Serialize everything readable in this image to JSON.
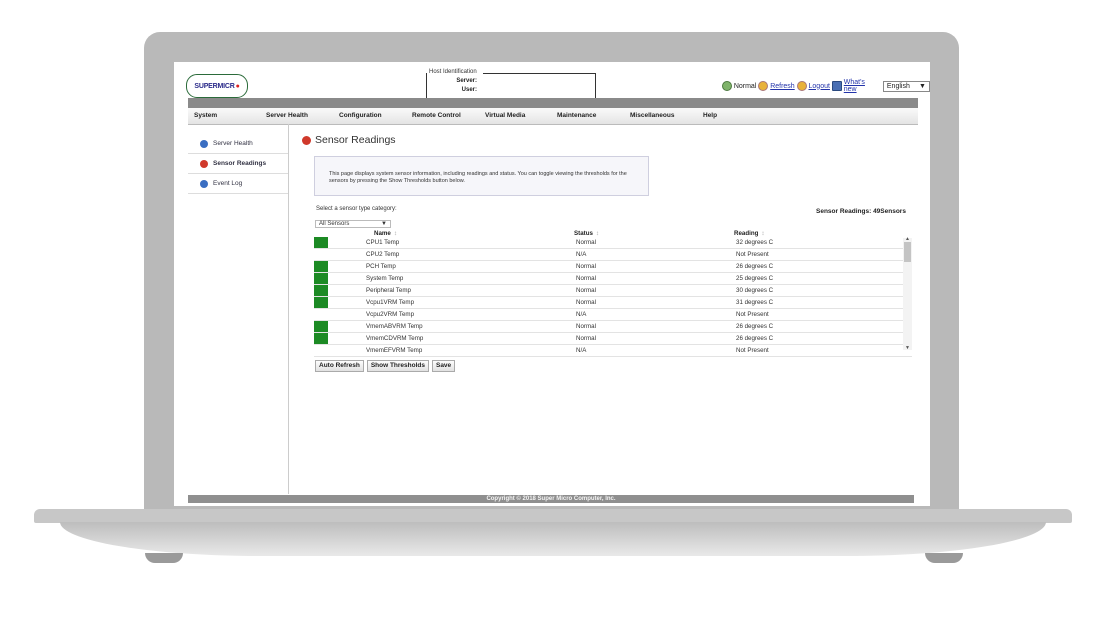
{
  "header": {
    "logo_text": "SUPERMICR",
    "logo_dot": "●",
    "host_legend": "Host Identification",
    "server_label": "Server:",
    "user_label": "User:",
    "status_text": "Normal",
    "refresh_label": "Refresh",
    "logout_label": "Logout",
    "whats_new_label": "What's new",
    "language": "English",
    "language_arrow": "▼"
  },
  "menu": {
    "items": [
      "System",
      "Server Health",
      "Configuration",
      "Remote Control",
      "Virtual Media",
      "Maintenance",
      "Miscellaneous",
      "Help"
    ]
  },
  "sidebar": {
    "items": [
      {
        "label": "Server Health",
        "icon": "blue-bullet-icon"
      },
      {
        "label": "Sensor Readings",
        "icon": "red-bullet-icon"
      },
      {
        "label": "Event Log",
        "icon": "blue-bullet-icon"
      }
    ]
  },
  "main": {
    "title": "Sensor Readings",
    "description": "This page displays system sensor information, including readings and status. You can toggle viewing the thresholds for the sensors by pressing the Show Thresholds button below.",
    "select_label": "Select a sensor type category:",
    "category_value": "All Sensors",
    "category_arrow": "▼",
    "sensor_count": "Sensor Readings: 49Sensors",
    "table": {
      "headers": [
        "Name",
        "Status",
        "Reading"
      ],
      "sort_glyph": "↕",
      "rows": [
        {
          "indicator": true,
          "name": "CPU1 Temp",
          "status": "Normal",
          "reading": "32 degrees C"
        },
        {
          "indicator": false,
          "name": "CPU2 Temp",
          "status": "N/A",
          "reading": "Not Present"
        },
        {
          "indicator": true,
          "name": "PCH Temp",
          "status": "Normal",
          "reading": "26 degrees C"
        },
        {
          "indicator": true,
          "name": "System Temp",
          "status": "Normal",
          "reading": "25 degrees C"
        },
        {
          "indicator": true,
          "name": "Peripheral Temp",
          "status": "Normal",
          "reading": "30 degrees C"
        },
        {
          "indicator": true,
          "name": "Vcpu1VRM Temp",
          "status": "Normal",
          "reading": "31 degrees C"
        },
        {
          "indicator": false,
          "name": "Vcpu2VRM Temp",
          "status": "N/A",
          "reading": "Not Present"
        },
        {
          "indicator": true,
          "name": "VmemABVRM Temp",
          "status": "Normal",
          "reading": "26 degrees C"
        },
        {
          "indicator": true,
          "name": "VmemCDVRM Temp",
          "status": "Normal",
          "reading": "26 degrees C"
        },
        {
          "indicator": false,
          "name": "VmemEFVRM Temp",
          "status": "N/A",
          "reading": "Not Present"
        }
      ]
    },
    "buttons": {
      "auto_refresh": "Auto Refresh",
      "show_thresholds": "Show Thresholds",
      "save": "Save"
    }
  },
  "footer": {
    "copyright": "Copyright © 2018 Super Micro Computer, Inc."
  },
  "colors": {
    "status_ok": "#1c8a24",
    "menu_bg": "#e4e4e4",
    "footer_bg": "#8f8f8f"
  }
}
